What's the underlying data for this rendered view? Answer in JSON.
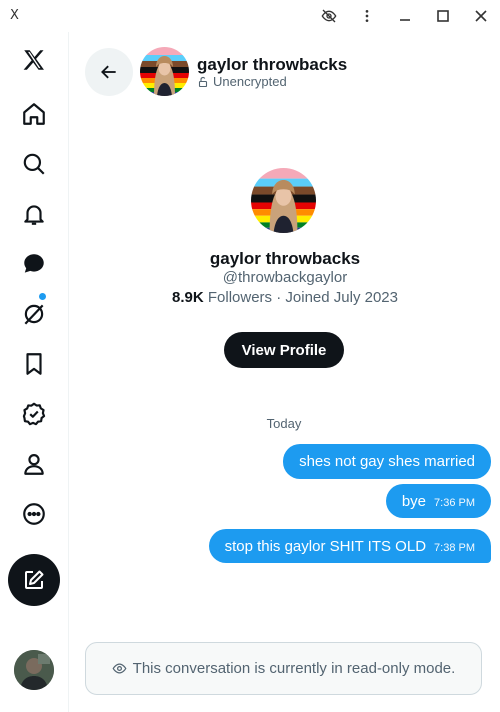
{
  "window": {
    "app_glyph": "X",
    "controls": [
      "eye-off-icon",
      "more-vertical-icon",
      "minimize-icon",
      "maximize-icon",
      "close-icon"
    ]
  },
  "sidebar": {
    "items": [
      {
        "name": "x-logo-icon"
      },
      {
        "name": "home-icon"
      },
      {
        "name": "search-icon"
      },
      {
        "name": "notifications-icon"
      },
      {
        "name": "messages-icon"
      },
      {
        "name": "grok-icon",
        "badge": true
      },
      {
        "name": "bookmarks-icon"
      },
      {
        "name": "verified-icon"
      },
      {
        "name": "profile-icon"
      },
      {
        "name": "more-icon"
      }
    ],
    "compose_icon": "compose-icon"
  },
  "header": {
    "name": "gaylor throwbacks",
    "status": "Unencrypted"
  },
  "profile": {
    "name": "gaylor throwbacks",
    "handle": "@throwbackgaylor",
    "followers_count": "8.9K",
    "followers_label": "Followers",
    "joined": "· Joined July 2023",
    "view_profile_label": "View Profile"
  },
  "conversation": {
    "date_label": "Today",
    "messages": [
      {
        "text": "shes not gay shes married",
        "time": ""
      },
      {
        "text": "bye",
        "time": "7:36 PM"
      },
      {
        "text": "stop this gaylor SHIT ITS OLD",
        "time": "7:38 PM"
      }
    ]
  },
  "footer": {
    "readonly_text": "This conversation is currently in read-only mode."
  },
  "colors": {
    "accent": "#1d9bf0",
    "dark": "#0f1419",
    "muted": "#536471"
  }
}
